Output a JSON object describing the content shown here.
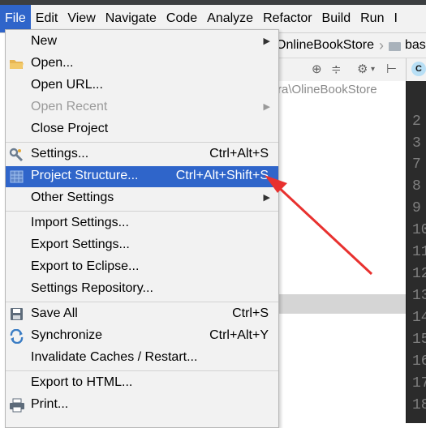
{
  "menubar": {
    "items": [
      {
        "label": "File",
        "active": true
      },
      {
        "label": "Edit"
      },
      {
        "label": "View"
      },
      {
        "label": "Navigate"
      },
      {
        "label": "Code"
      },
      {
        "label": "Analyze"
      },
      {
        "label": "Refactor"
      },
      {
        "label": "Build"
      },
      {
        "label": "Run"
      },
      {
        "label": "I"
      }
    ]
  },
  "navbar": {
    "crumb1": "OnlineBookStore",
    "crumb2": "bas"
  },
  "project_pane": {
    "path": "ra\\OlineBookStore"
  },
  "editor": {
    "tab_icon_letter": "C"
  },
  "gutter": {
    "lines": [
      "2",
      "3",
      "7",
      "8",
      "9",
      "10",
      "11",
      "12",
      "13",
      "14",
      "15",
      "16",
      "17",
      "18"
    ]
  },
  "file_menu": {
    "new": {
      "label": "New"
    },
    "open": {
      "label": "Open..."
    },
    "open_url": {
      "label": "Open URL..."
    },
    "open_recent": {
      "label": "Open Recent"
    },
    "close_project": {
      "label": "Close Project"
    },
    "settings": {
      "label": "Settings...",
      "shortcut": "Ctrl+Alt+S"
    },
    "project_structure": {
      "label": "Project Structure...",
      "shortcut": "Ctrl+Alt+Shift+S"
    },
    "other_settings": {
      "label": "Other Settings"
    },
    "import_settings": {
      "label": "Import Settings..."
    },
    "export_settings": {
      "label": "Export Settings..."
    },
    "export_eclipse": {
      "label": "Export to Eclipse..."
    },
    "settings_repo": {
      "label": "Settings Repository..."
    },
    "save_all": {
      "label": "Save All",
      "shortcut": "Ctrl+S"
    },
    "synchronize": {
      "label": "Synchronize",
      "shortcut": "Ctrl+Alt+Y"
    },
    "invalidate": {
      "label": "Invalidate Caches / Restart..."
    },
    "export_html": {
      "label": "Export to HTML..."
    },
    "print": {
      "label": "Print..."
    }
  },
  "colors": {
    "highlight": "#2f65ca",
    "annotation": "#e8312f",
    "menu_bg": "#f2f2f2"
  }
}
